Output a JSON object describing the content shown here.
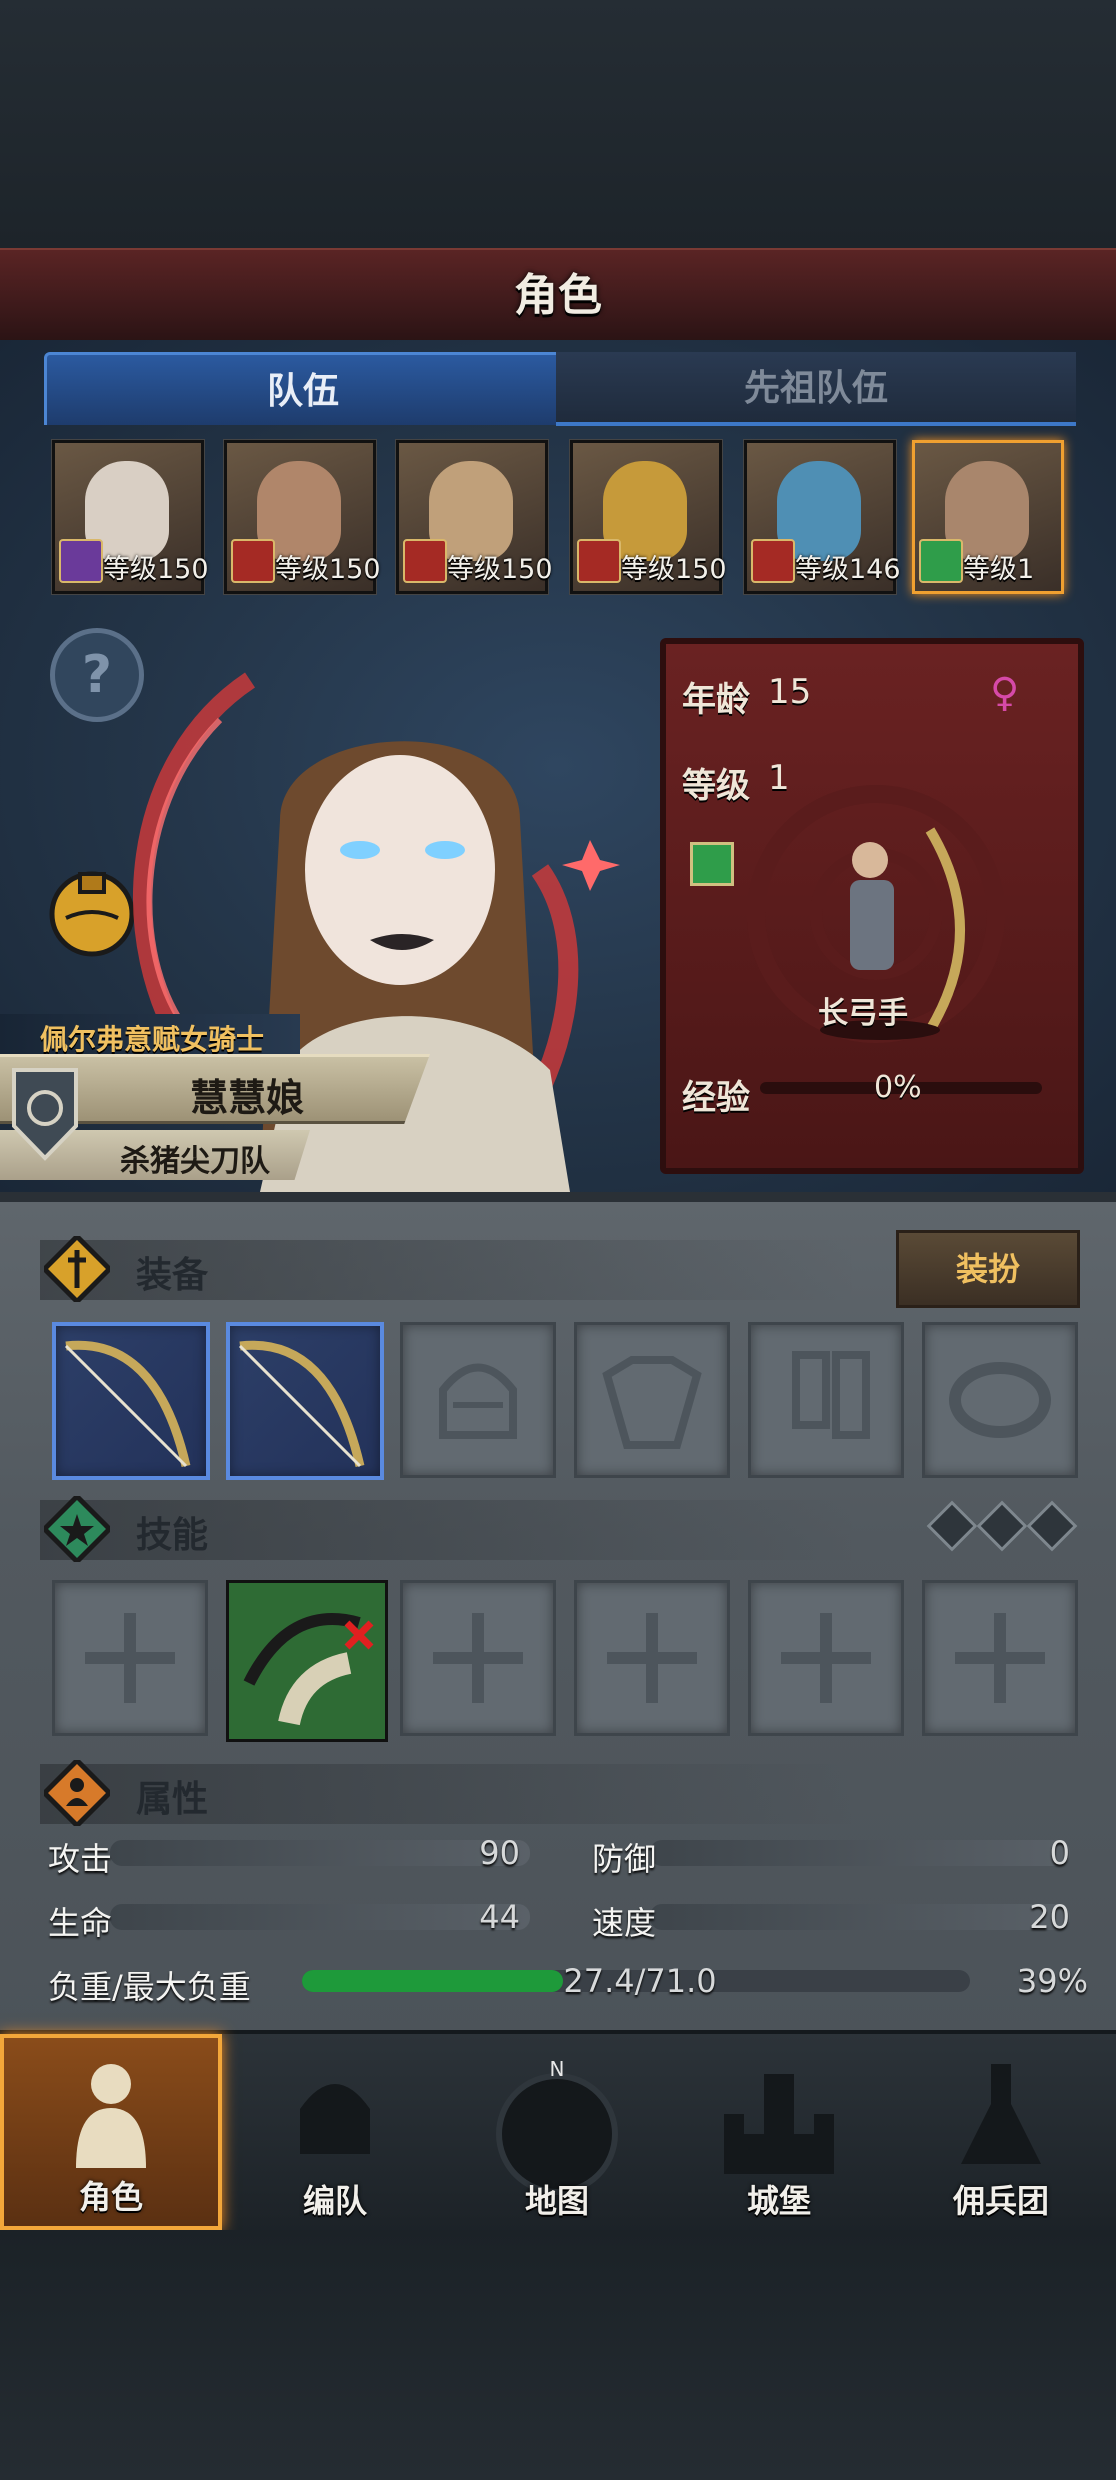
{
  "header": {
    "title": "角色"
  },
  "tabs": [
    {
      "label": "队伍"
    },
    {
      "label": "先祖队伍"
    }
  ],
  "roster": [
    {
      "level": "等级150",
      "class_icon": "mage-icon"
    },
    {
      "level": "等级150",
      "class_icon": "horse-icon"
    },
    {
      "level": "等级150",
      "class_icon": "horse-icon"
    },
    {
      "level": "等级150",
      "class_icon": "horse-icon"
    },
    {
      "level": "等级146",
      "class_icon": "horse-icon"
    },
    {
      "level": "等级1",
      "class_icon": "archer-icon"
    }
  ],
  "hero": {
    "subtitle": "佩尔弗意赋女骑士",
    "name": "慧慧娘",
    "team": "杀猪尖刀队",
    "help": "?"
  },
  "card": {
    "age_label": "年龄",
    "age": "15",
    "level_label": "等级",
    "level": "1",
    "class_name": "长弓手",
    "exp_label": "经验",
    "exp_pct": "0%",
    "gender_icon": "female-icon"
  },
  "equipment": {
    "title": "装备",
    "dress_button": "装扮",
    "slots": [
      "bow-icon",
      "bow-icon",
      "helmet-icon",
      "armor-icon",
      "boots-icon",
      "ring-icon"
    ]
  },
  "skills": {
    "title": "技能",
    "slots": [
      "empty-cross-icon",
      "arrow-skill-icon",
      "empty-cross-icon",
      "empty-cross-icon",
      "empty-cross-icon",
      "empty-cross-icon"
    ]
  },
  "attributes": {
    "title": "属性",
    "attack_label": "攻击",
    "attack": "90",
    "defense_label": "防御",
    "defense": "0",
    "hp_label": "生命",
    "hp": "44",
    "speed_label": "速度",
    "speed": "20",
    "load_label": "负重/最大负重",
    "load": "27.4/71.0",
    "load_pct": "39%",
    "load_fraction": 0.39
  },
  "nav": [
    {
      "label": "角色",
      "icon": "knight-icon",
      "active": true
    },
    {
      "label": "编队",
      "icon": "helmet-icon"
    },
    {
      "label": "地图",
      "icon": "compass-icon"
    },
    {
      "label": "城堡",
      "icon": "castle-icon"
    },
    {
      "label": "佣兵团",
      "icon": "mercenary-icon"
    }
  ],
  "colors": {
    "accent": "#f3a73a",
    "tab_active": "#2b5aa0",
    "load_fill": "#1e9a3a"
  }
}
